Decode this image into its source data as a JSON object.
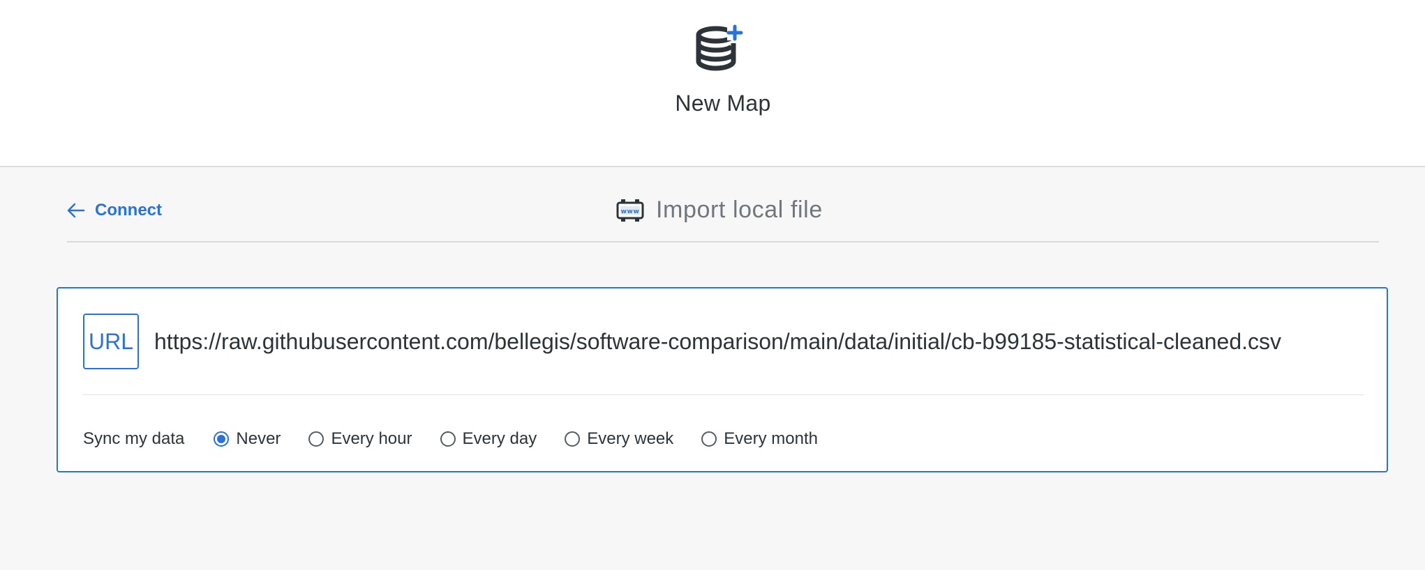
{
  "header": {
    "title": "New Map",
    "icon": "database-plus-icon",
    "icon_color": "#2c3439",
    "accent_color": "#2a72d8"
  },
  "subnav": {
    "back_label": "Connect",
    "back_icon": "arrow-left-icon",
    "title": "Import local file",
    "title_icon": "www-icon"
  },
  "url_panel": {
    "badge": "URL",
    "url_value": "https://raw.githubusercontent.com/bellegis/software-comparison/main/data/initial/cb-b99185-statistical-cleaned.csv"
  },
  "sync": {
    "label": "Sync my data",
    "options": [
      "Never",
      "Every hour",
      "Every day",
      "Every week",
      "Every month"
    ],
    "selected": "Never"
  }
}
